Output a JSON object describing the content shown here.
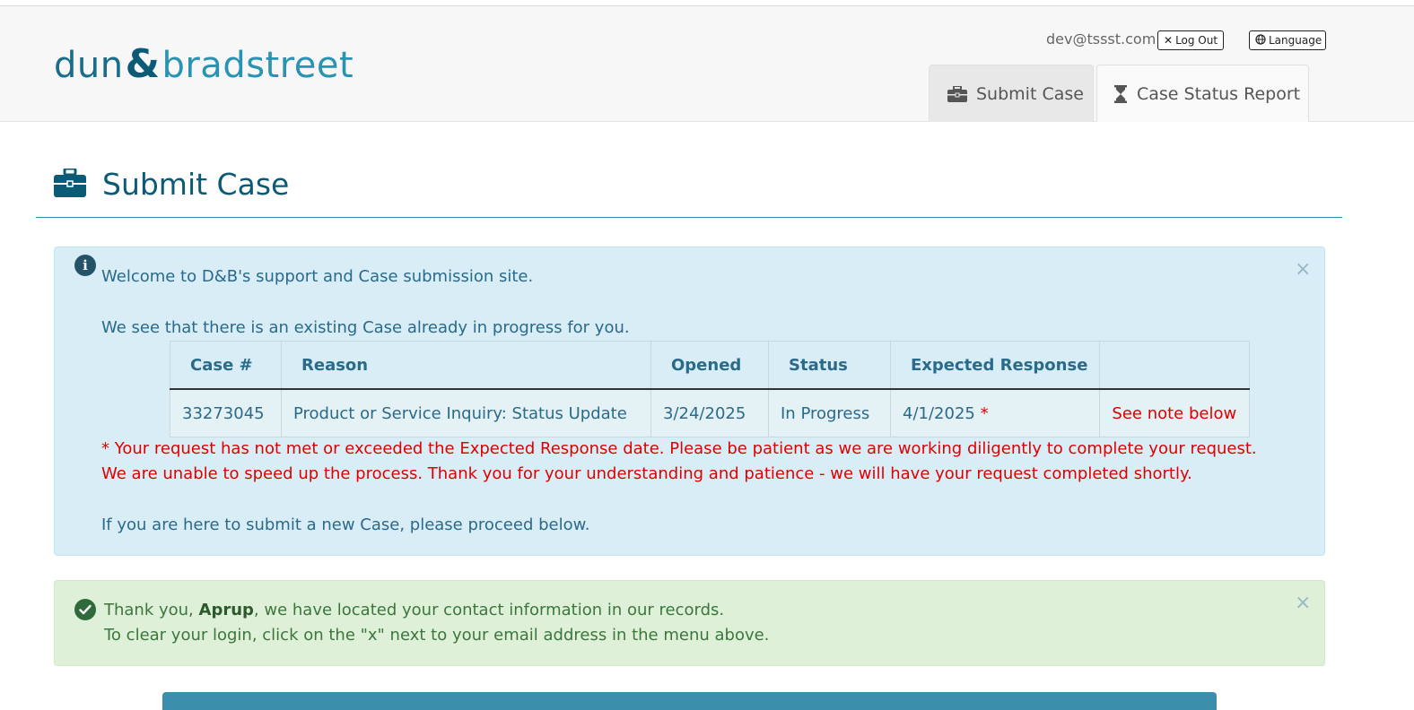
{
  "header": {
    "logo": {
      "part1": "dun",
      "amp": "&",
      "part2": "bradstreet"
    },
    "user_email": "dev@tssst.com",
    "logout_label": "Log Out",
    "language_label": "Language",
    "tabs": [
      {
        "label": "Submit Case",
        "icon": "briefcase-icon",
        "active": true
      },
      {
        "label": "Case Status Report",
        "icon": "hourglass-icon",
        "active": false
      }
    ]
  },
  "page": {
    "title": "Submit Case",
    "title_icon": "briefcase-icon"
  },
  "info_alert": {
    "line1": "Welcome to D&B's support and Case submission site.",
    "line2": "We see that there is an existing Case already in progress for you.",
    "table": {
      "headers": [
        "Case #",
        "Reason",
        "Opened",
        "Status",
        "Expected Response",
        ""
      ],
      "row": {
        "case_number": "33273045",
        "reason": "Product or Service Inquiry: Status Update",
        "opened": "3/24/2025",
        "status": "In Progress",
        "expected_response": "4/1/2025",
        "expected_marker": "*",
        "note_link": "See note below"
      }
    },
    "note_line1": "* Your request has not met or exceeded the Expected Response date. Please be patient as we are working diligently to complete your request.",
    "note_line2": "We are unable to speed up the process. Thank you for your understanding and patience - we will have your request completed shortly.",
    "line3": "If you are here to submit a new Case, please proceed below.",
    "close": "×"
  },
  "success_alert": {
    "prefix": "Thank you, ",
    "name": "Aprup",
    "suffix": ", we have located your contact information in our records.",
    "line2": "To clear your login, click on the \"x\" next to your email address in the menu above.",
    "close": "×"
  },
  "colors": {
    "brand_dark": "#0b5a76",
    "brand_light": "#2893b3",
    "info_bg": "#d9edf7",
    "success_bg": "#dff0d8",
    "error_red": "#e00000"
  }
}
